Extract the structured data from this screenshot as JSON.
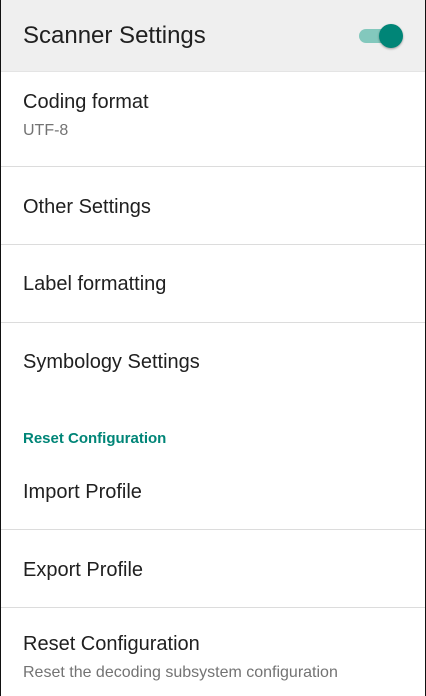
{
  "header": {
    "title": "Scanner Settings",
    "toggle_state": "on",
    "accent_color": "#008577"
  },
  "preferences": {
    "coding_format": {
      "title": "Coding format",
      "summary": "UTF-8"
    },
    "other_settings": {
      "title": "Other Settings"
    },
    "label_formatting": {
      "title": "Label formatting"
    },
    "symbology_settings": {
      "title": "Symbology Settings"
    }
  },
  "reset_section": {
    "header": "Reset Configuration",
    "import_profile": {
      "title": "Import Profile"
    },
    "export_profile": {
      "title": "Export Profile"
    },
    "reset_configuration": {
      "title": "Reset Configuration",
      "summary": "Reset the decoding subsystem configuration"
    }
  }
}
